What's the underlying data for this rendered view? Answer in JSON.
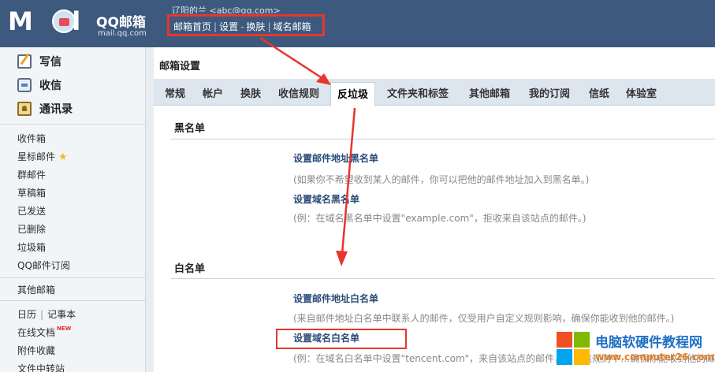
{
  "header": {
    "logo_text": "MAIL",
    "brand": "QQ邮箱",
    "domain": "mail.qq.com",
    "user_line": "辽阳的兰 <abc@qq.com>",
    "links": [
      "邮箱首页",
      "设置",
      "换肤",
      "域名邮箱"
    ],
    "separators": [
      "|",
      "-",
      "|"
    ]
  },
  "sidebar": {
    "actions": [
      {
        "label": "写信",
        "icon": "write-icon"
      },
      {
        "label": "收信",
        "icon": "inbox-icon"
      },
      {
        "label": "通讯录",
        "icon": "contacts-icon"
      }
    ],
    "folders": [
      "收件箱",
      "星标邮件",
      "群邮件",
      "草稿箱",
      "已发送",
      "已删除",
      "垃圾箱",
      "QQ邮件订阅"
    ],
    "other_mailbox": "其他邮箱",
    "calendar": "日历",
    "notepad": "记事本",
    "online_docs": "在线文档",
    "new_badge": "NEW",
    "attachments": "附件收藏",
    "file_transfer": "文件中转站"
  },
  "main": {
    "title": "邮箱设置",
    "tabs": [
      "常规",
      "帐户",
      "换肤",
      "收信规则",
      "反垃圾",
      "文件夹和标签",
      "其他邮箱",
      "我的订阅",
      "信纸",
      "体验室"
    ],
    "active_tab": "反垃圾",
    "blacklist": {
      "title": "黑名单",
      "address_link": "设置邮件地址黑名单",
      "address_desc": "(如果你不希望收到某人的邮件，你可以把他的邮件地址加入到黑名单。)",
      "domain_link": "设置域名黑名单",
      "domain_desc": "(例：在域名黑名单中设置\"example.com\"，拒收来自该站点的邮件。)"
    },
    "whitelist": {
      "title": "白名单",
      "address_link": "设置邮件地址白名单",
      "address_desc": "(来自邮件地址白名单中联系人的邮件，仅受用户自定义规则影响，确保你能收到他的邮件。)",
      "domain_link": "设置域名白名单",
      "domain_desc": "(例：在域名白名单中设置\"tencent.com\"，来自该站点的邮件，在收信规则中…确保你能收到他的邮件。)"
    }
  },
  "watermark": {
    "line1": "电脑软硬件教程网",
    "line2": "www.computer26.com"
  },
  "colors": {
    "header_bg": "#3d5a7e",
    "annotation_red": "#e8352e",
    "link_blue": "#2a4d7a"
  }
}
